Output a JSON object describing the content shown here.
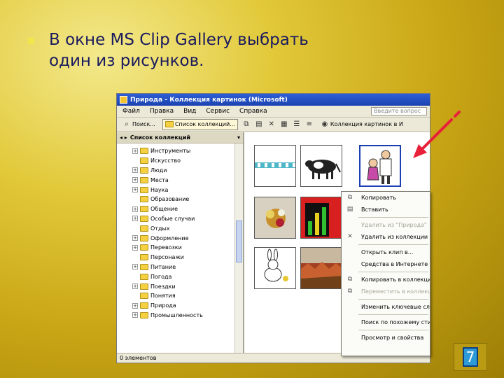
{
  "slide": {
    "bullet_line1": "В окне MS Clip Gallery выбрать",
    "bullet_line2": "один из рисунков.",
    "slide_number": "7",
    "accent_color": "#e8203a"
  },
  "window": {
    "title": "Природа - Коллекция картинок (Microsoft)",
    "menu": [
      "Файл",
      "Правка",
      "Вид",
      "Сервис",
      "Справка"
    ],
    "help_placeholder": "Введите вопрос",
    "toolbar": {
      "search_label": "Поиск...",
      "collections_label": "Список коллекций...",
      "clip_gallery_label": "Коллекция картинок в И"
    },
    "pane_title": "Список коллекций",
    "tree": [
      {
        "label": "Инструменты",
        "expandable": true
      },
      {
        "label": "Искусство",
        "expandable": false
      },
      {
        "label": "Люди",
        "expandable": true
      },
      {
        "label": "Места",
        "expandable": true
      },
      {
        "label": "Наука",
        "expandable": true
      },
      {
        "label": "Образование",
        "expandable": false
      },
      {
        "label": "Общение",
        "expandable": true
      },
      {
        "label": "Особые случаи",
        "expandable": true
      },
      {
        "label": "Отдых",
        "expandable": false
      },
      {
        "label": "Оформление",
        "expandable": true
      },
      {
        "label": "Перевозки",
        "expandable": true
      },
      {
        "label": "Персонажи",
        "expandable": false
      },
      {
        "label": "Питание",
        "expandable": true
      },
      {
        "label": "Погода",
        "expandable": false
      },
      {
        "label": "Поездки",
        "expandable": true
      },
      {
        "label": "Понятия",
        "expandable": false
      },
      {
        "label": "Природа",
        "expandable": true
      },
      {
        "label": "Промышленность",
        "expandable": true
      }
    ],
    "context_menu": [
      {
        "label": "Копировать",
        "icon": "copy-icon",
        "enabled": true
      },
      {
        "label": "Вставить",
        "icon": "paste-icon",
        "enabled": true
      },
      {
        "label": "Удалить из \"Природа\"",
        "icon": "",
        "enabled": false
      },
      {
        "label": "Удалить из коллекции",
        "icon": "delete-icon",
        "enabled": true
      },
      {
        "label": "Открыть клип в...",
        "icon": "",
        "enabled": true
      },
      {
        "label": "Средства в Интернете",
        "icon": "",
        "enabled": true
      },
      {
        "label": "Копировать в коллекцию",
        "icon": "copy-to-collection-icon",
        "enabled": true
      },
      {
        "label": "Переместить в коллекцию",
        "icon": "move-to-collection-icon",
        "enabled": false
      },
      {
        "label": "Изменить ключевые слова",
        "icon": "",
        "enabled": true
      },
      {
        "label": "Поиск по похожему стилю",
        "icon": "",
        "enabled": true
      },
      {
        "label": "Просмотр и свойства",
        "icon": "",
        "enabled": true
      }
    ],
    "status": "0 элементов"
  }
}
